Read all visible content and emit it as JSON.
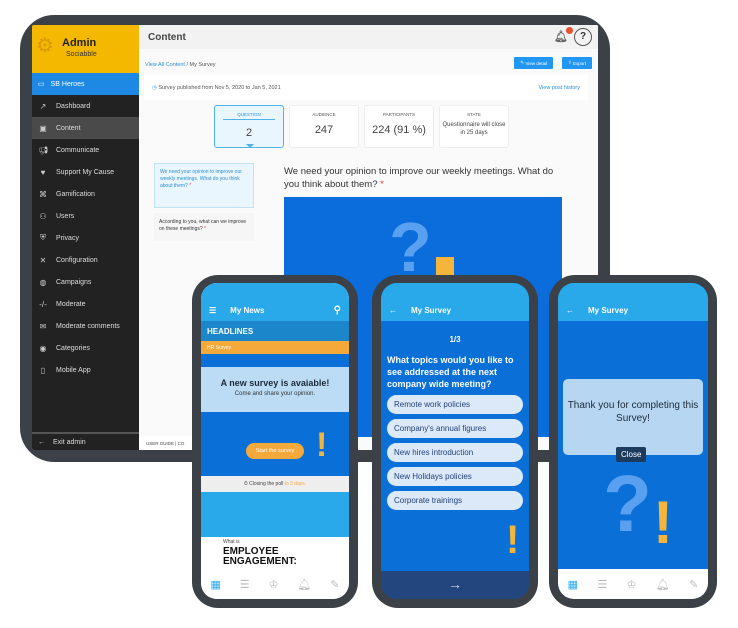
{
  "admin": {
    "logo": {
      "title": "Admin",
      "subtitle": "Sociabble"
    },
    "sidebar": {
      "active_brand": "SB Heroes",
      "items": [
        {
          "label": "Dashboard",
          "icon": "chart-trend-icon"
        },
        {
          "label": "Content",
          "icon": "content-icon",
          "active": true
        },
        {
          "label": "Communicate",
          "icon": "megaphone-icon"
        },
        {
          "label": "Support My Cause",
          "icon": "hand-heart-icon"
        },
        {
          "label": "Gamification",
          "icon": "gamepad-icon"
        },
        {
          "label": "Users",
          "icon": "users-icon"
        },
        {
          "label": "Privacy",
          "icon": "privacy-icon"
        },
        {
          "label": "Configuration",
          "icon": "tools-icon"
        },
        {
          "label": "Campaigns",
          "icon": "globe-icon"
        },
        {
          "label": "Moderate",
          "icon": "code-icon"
        },
        {
          "label": "Moderate comments",
          "icon": "comment-icon"
        },
        {
          "label": "Categories",
          "icon": "toggle-icon"
        },
        {
          "label": "Mobile App",
          "icon": "mobile-icon"
        }
      ],
      "exit": "Exit admin"
    },
    "topbar": {
      "title": "Content",
      "notification_count": "1"
    },
    "breadcrumb": {
      "link": "View All Content",
      "current": "My Survey"
    },
    "buttons": {
      "view_detail": "View detail",
      "export": "Export"
    },
    "published": "Survey published from Nov 5, 2020 to Jan 5, 2021",
    "view_history": "View post history",
    "stats": [
      {
        "label": "QUESTION",
        "value": "2"
      },
      {
        "label": "AUDIENCE",
        "value": "247"
      },
      {
        "label": "PARTICIPANTS",
        "value": "224 (91 %)"
      },
      {
        "label": "STATE",
        "value": "Questionnaire will close in 25 days"
      }
    ],
    "questions": [
      "We need your opinion to improve our weekly meetings. What do you think about them?",
      "According to you, what can we improve on these meetings?"
    ],
    "question_title": "We need your opinion to improve our weekly meetings. What do you think about them?",
    "footer": "USER GUIDE | CO"
  },
  "phone1": {
    "title": "My News",
    "headlines": "HEADLINES",
    "tag": "HR Survey",
    "card_title": "A new survey is avaiable!",
    "card_sub": "Come and share your opinion.",
    "start": "Start the survey",
    "closing_prefix": "Closing the poll ",
    "closing_days": "in 3 days.",
    "blog_what": "What is",
    "blog_title": "EMPLOYEE ENGAGEMENT:"
  },
  "phone2": {
    "title": "My Survey",
    "progress": "1/3",
    "question": "What topics would you like to see addressed at the next company wide meeting?",
    "options": [
      "Remote work policies",
      "Company's annual figures",
      "New hires introduction",
      "New Holidays policies",
      "Corporate trainings"
    ]
  },
  "phone3": {
    "title": "My Survey",
    "message": "Thank you for completing this Survey!",
    "close": "Close"
  },
  "colors": {
    "brand_yellow": "#f5b800",
    "primary_blue": "#2196f3",
    "phone_header": "#29a8ea",
    "accent_orange": "#f6a93b"
  }
}
